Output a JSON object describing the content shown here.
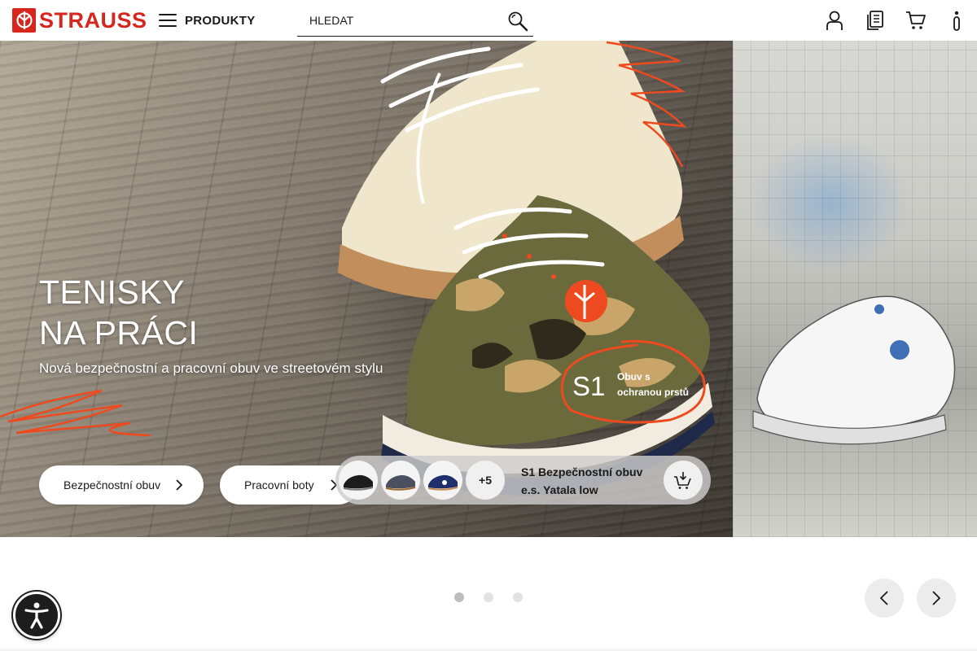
{
  "header": {
    "logo_text": "STRAUSS",
    "menu_label": "PRODUKTY",
    "search_placeholder": "HLEDAT",
    "icons": [
      "account-icon",
      "catalog-icon",
      "cart-icon",
      "info-icon"
    ]
  },
  "hero": {
    "title_line1": "TENISKY",
    "title_line2": "NA PRÁCI",
    "subtitle": "Nová bezpečnostní a pracovní obuv ve streetovém stylu",
    "badge_big": "S1",
    "badge_small_line1": "Obuv s",
    "badge_small_line2": "ochranou prstů",
    "buttons": [
      {
        "label": "Bezpečnostní obuv"
      },
      {
        "label": "Pracovní boty"
      }
    ],
    "product": {
      "more_count": "+5",
      "name_line1": "S1 Bezpečnostní obuv",
      "name_line2": "e.s. Yatala low",
      "thumb_colors": [
        "#1c1c1c",
        "#4a5060",
        "#1f2f6b"
      ]
    }
  },
  "carousel": {
    "dots": 3,
    "active_dot": 0
  },
  "colors": {
    "brand_red": "#d7261e",
    "accent_orange": "#ee4a1f"
  }
}
